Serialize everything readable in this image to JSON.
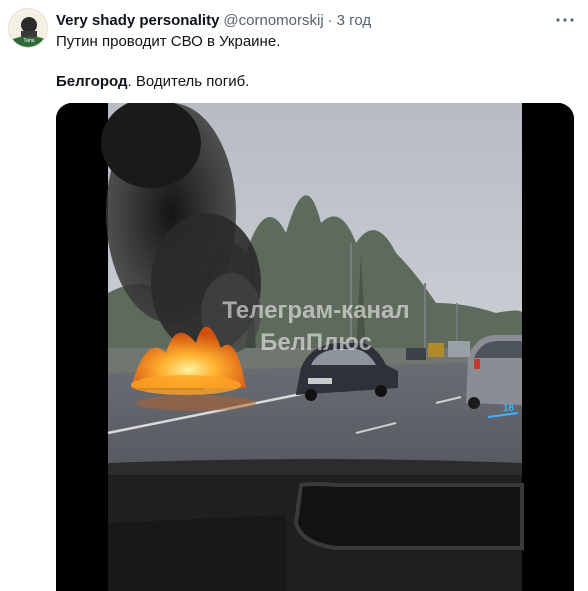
{
  "tweet": {
    "display_name": "Very shady personality",
    "handle": "@cornomorskij",
    "separator": "·",
    "time": "3 год",
    "text_line1": "Путин проводит СВО в Украине.",
    "text_place": "Белгород",
    "text_rest": ". Водитель погиб."
  },
  "video": {
    "watermark_line1": "Телеграм-канал",
    "watermark_line2": "БелПлюс",
    "speed_readout": "18"
  },
  "avatar": {
    "label": "Типа"
  },
  "colors": {
    "text": "#0f1419",
    "secondary": "#536471",
    "fire": "#ff7a12",
    "smoke": "#1e1e1e"
  },
  "icons": {
    "more": "more-horizontal-icon"
  }
}
